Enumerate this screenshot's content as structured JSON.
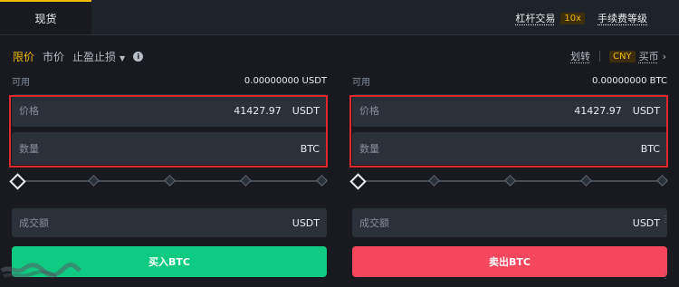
{
  "header": {
    "tab_spot": "现货",
    "margin_link": "杠杆交易",
    "leverage_badge": "10x",
    "fee_link": "手续费等级"
  },
  "order_types": {
    "limit": "限价",
    "market": "市价",
    "stop_limit": "止盈止损",
    "transfer": "划转",
    "currency_badge": "CNY",
    "buy_crypto": "买币"
  },
  "buy_panel": {
    "available_label": "可用",
    "available_value": "0.00000000 USDT",
    "price_label": "价格",
    "price_value": "41427.97",
    "price_unit": "USDT",
    "amount_label": "数量",
    "amount_unit": "BTC",
    "total_label": "成交额",
    "total_unit": "USDT",
    "button_label": "买入BTC"
  },
  "sell_panel": {
    "available_label": "可用",
    "available_value": "0.00000000 BTC",
    "price_label": "价格",
    "price_value": "41427.97",
    "price_unit": "USDT",
    "amount_label": "数量",
    "amount_unit": "BTC",
    "total_label": "成交额",
    "total_unit": "USDT",
    "button_label": "卖出BTC"
  },
  "colors": {
    "accent": "#f0b90b",
    "buy": "#0ecb81",
    "sell": "#f6465d",
    "highlight": "#e0262e"
  }
}
